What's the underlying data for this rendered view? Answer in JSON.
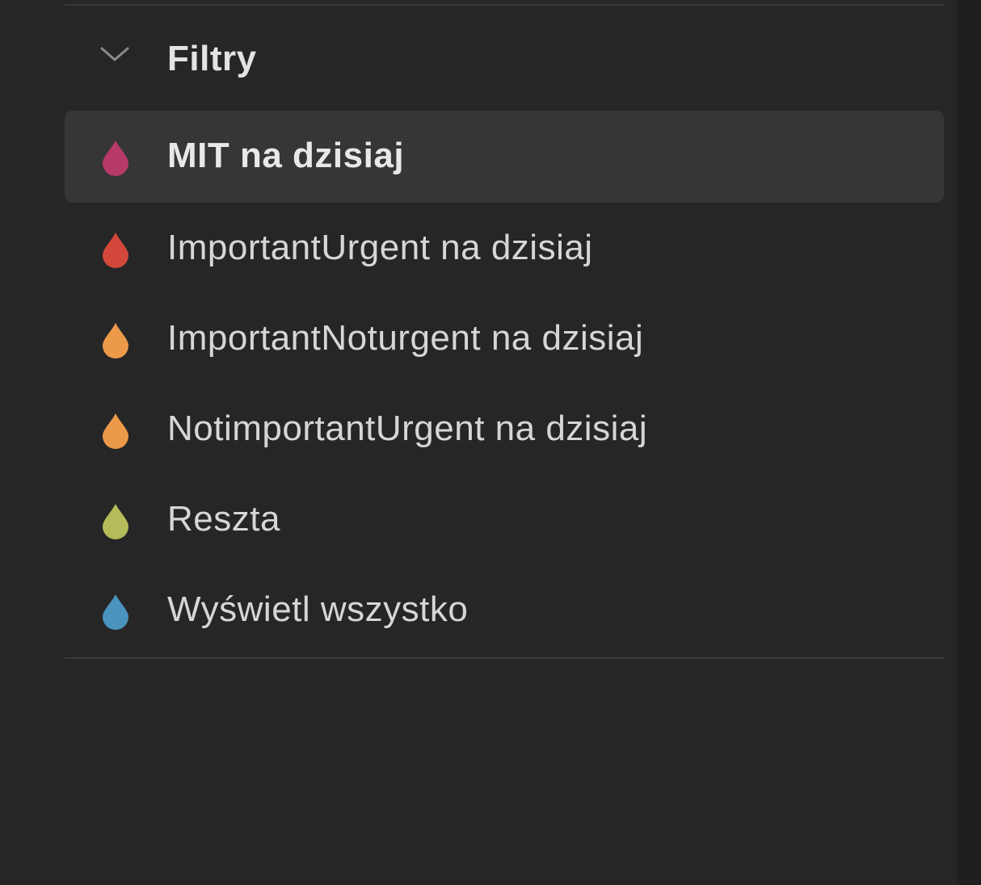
{
  "section": {
    "title": "Filtry",
    "chevron_icon": "chevron-down-icon"
  },
  "filters": [
    {
      "label": "MIT na dzisiaj",
      "color": "#b83a68",
      "icon": "drop-icon",
      "active": true
    },
    {
      "label": "ImportantUrgent na dzisiaj",
      "color": "#d4483c",
      "icon": "drop-icon",
      "active": false
    },
    {
      "label": "ImportantNoturgent na dzisiaj",
      "color": "#ec9a4a",
      "icon": "drop-icon",
      "active": false
    },
    {
      "label": "NotimportantUrgent na dzisiaj",
      "color": "#ec9a4a",
      "icon": "drop-icon",
      "active": false
    },
    {
      "label": "Reszta",
      "color": "#b3bc58",
      "icon": "drop-icon",
      "active": false
    },
    {
      "label": "Wyświetl wszystko",
      "color": "#4a93bd",
      "icon": "drop-icon",
      "active": false
    }
  ]
}
